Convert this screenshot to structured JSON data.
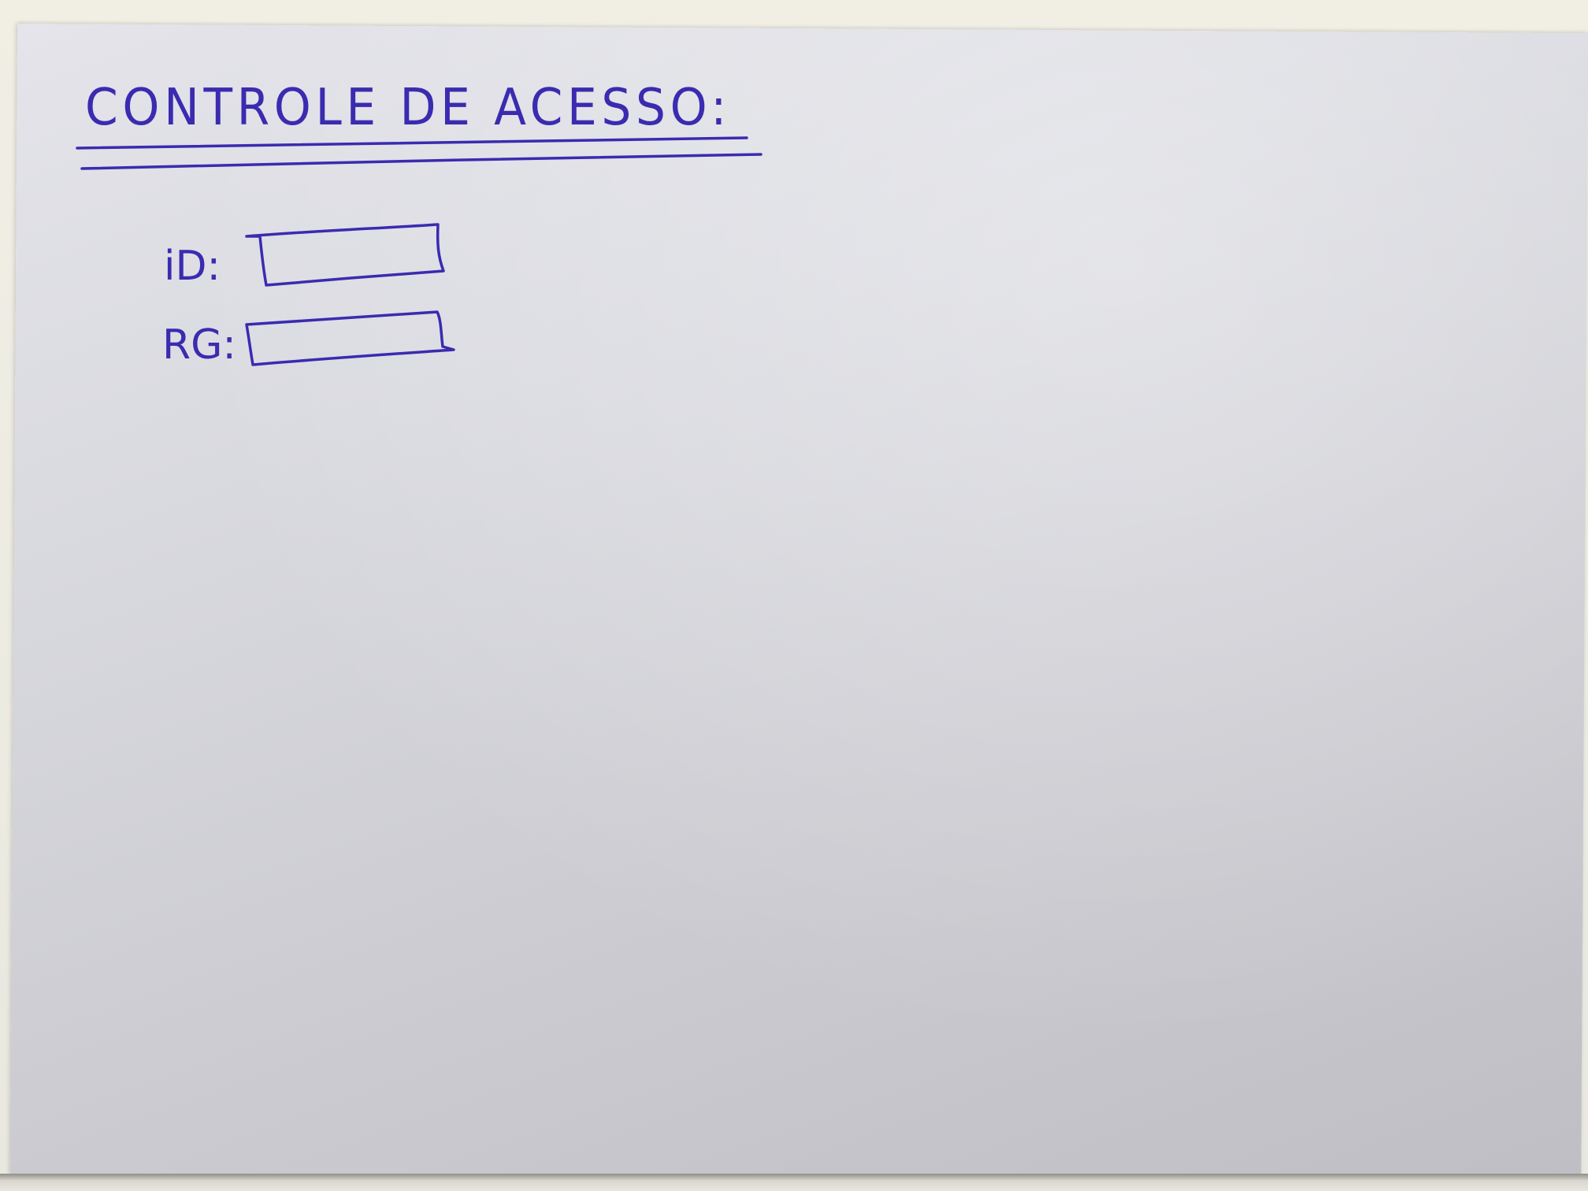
{
  "form": {
    "title": "CONTROLE DE ACESSO:",
    "fields": [
      {
        "label": "iD:",
        "value": ""
      },
      {
        "label": "RG:",
        "value": ""
      }
    ]
  },
  "colors": {
    "ink": "#3a2bb0"
  }
}
